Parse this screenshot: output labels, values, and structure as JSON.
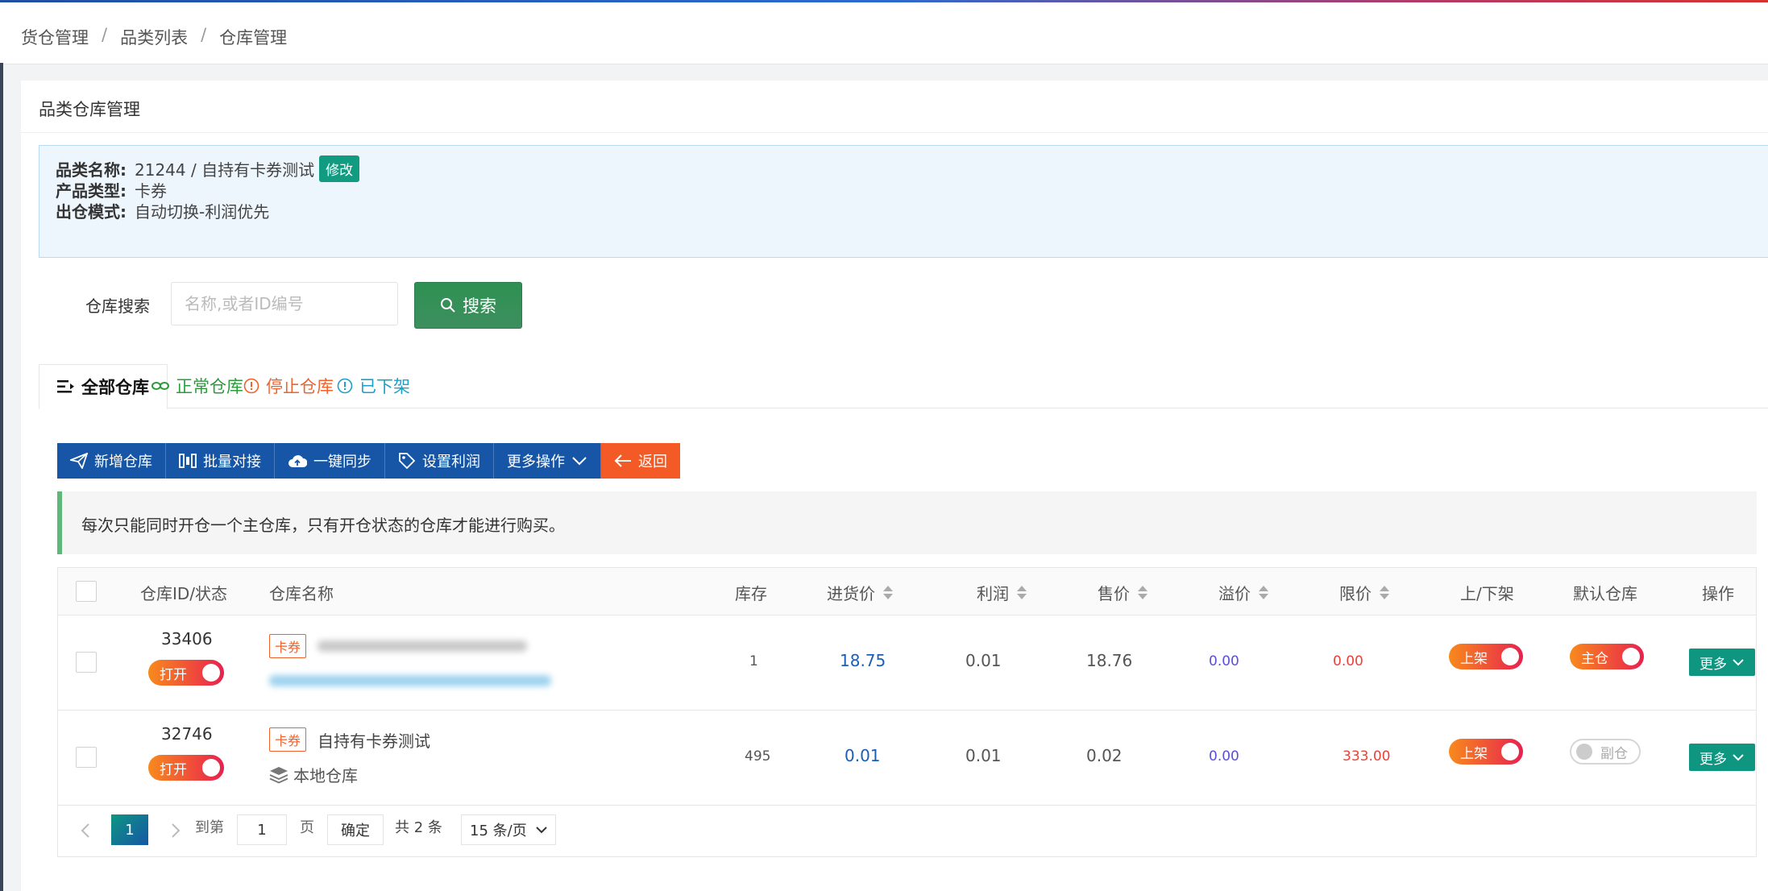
{
  "breadcrumb": [
    "货仓管理",
    "品类列表",
    "仓库管理"
  ],
  "card_title": "品类仓库管理",
  "info": {
    "name_label": "品类名称:",
    "name_value": "21244 / 自持有卡券测试",
    "edit_label": "修改",
    "type_label": "产品类型:",
    "type_value": "卡券",
    "mode_label": "出仓模式:",
    "mode_value": "自动切换-利润优先"
  },
  "search": {
    "label": "仓库搜索",
    "placeholder": "名称,或者ID编号",
    "button": "搜索"
  },
  "tabs": [
    {
      "label": "全部仓库",
      "active": true,
      "color": "#111111",
      "icon": "list-icon"
    },
    {
      "label": "正常仓库",
      "active": false,
      "color": "#2a9d3a",
      "icon": "link-icon"
    },
    {
      "label": "停止仓库",
      "active": false,
      "color": "#f0622b",
      "icon": "info-icon"
    },
    {
      "label": "已下架",
      "active": false,
      "color": "#1e9fc9",
      "icon": "info-icon"
    }
  ],
  "toolbar": {
    "add": "新增仓库",
    "batch": "批量对接",
    "sync": "一键同步",
    "profit": "设置利润",
    "more": "更多操作",
    "back": "返回"
  },
  "notice": "每次只能同时开仓一个主仓库，只有开仓状态的仓库才能进行购买。",
  "table": {
    "headers": {
      "id_status": "仓库ID/状态",
      "name": "仓库名称",
      "stock": "库存",
      "cost": "进货价",
      "profit": "利润",
      "price": "售价",
      "premium": "溢价",
      "limit": "限价",
      "shelf": "上/下架",
      "default": "默认仓库",
      "action": "操作"
    },
    "rows": [
      {
        "id": "33406",
        "status": "打开",
        "tag": "卡券",
        "name": "",
        "sub": "",
        "stock": "1",
        "cost": "18.75",
        "profit": "0.01",
        "price": "18.76",
        "premium": "0.00",
        "limit": "0.00",
        "shelf": "上架",
        "default": "主仓",
        "default_on": true,
        "action": "更多"
      },
      {
        "id": "32746",
        "status": "打开",
        "tag": "卡券",
        "name": "自持有卡券测试",
        "sub": "本地仓库",
        "stock": "495",
        "cost": "0.01",
        "profit": "0.01",
        "price": "0.02",
        "premium": "0.00",
        "limit": "333.00",
        "shelf": "上架",
        "default": "副仓",
        "default_on": false,
        "action": "更多"
      }
    ]
  },
  "pager": {
    "current": "1",
    "goto_label": "到第",
    "goto_value": "1",
    "page_label": "页",
    "confirm": "确定",
    "total": "共 2 条",
    "page_size": "15 条/页"
  },
  "colors": {
    "primary_blue": "#1756a6",
    "orange": "#f35a25",
    "teal": "#0e9681",
    "cost_blue": "#1a5fb4",
    "premium_purple": "#5b4fd6",
    "limit_red": "#e8423b"
  }
}
